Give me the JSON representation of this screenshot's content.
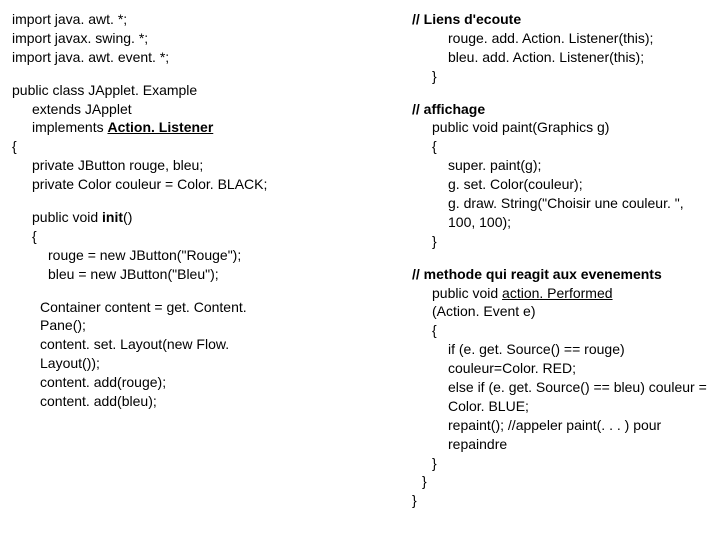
{
  "left": {
    "imports": [
      "import java. awt. *;",
      "import javax. swing. *;",
      "import java. awt. event. *;"
    ],
    "cls1": "public class JApplet. Example",
    "cls2": "extends JApplet",
    "cls3a": "implements ",
    "cls3b": "Action. Listener",
    "obr": "{",
    "priv1": "private JButton rouge, bleu;",
    "priv2": "private Color couleur = Color. BLACK;",
    "init1a": "public void ",
    "init1b": "init",
    "init1c": "()",
    "init2": "{",
    "init3": "rouge = new JButton(\"Rouge\");",
    "init4": "bleu = new JButton(\"Bleu\");",
    "cont1": "Container content = get. Content. Pane();",
    "cont2": "content. set. Layout(new Flow. Layout());",
    "cont3": "content. add(rouge);",
    "cont4": "content. add(bleu);"
  },
  "right": {
    "lh": "// Liens d'ecoute",
    "l1": "rouge. add. Action. Listener(this);",
    "l2": "bleu. add. Action. Listener(this);",
    "l3": "}",
    "ah": "// affichage",
    "a1": "public void paint(Graphics g)",
    "a2": "{",
    "a3": "super. paint(g);",
    "a4": "g. set. Color(couleur);",
    "a5": "g. draw. String(\"Choisir une couleur. \", 100, 100);",
    "a6": "}",
    "mh": "// methode qui reagit aux evenements",
    "m1a": "public void ",
    "m1b": "action. Performed",
    "m2": "(Action. Event e)",
    "m3": "{",
    "m4": "if (e. get. Source() == rouge) couleur=Color. RED;",
    "m5": "else if (e. get. Source() == bleu) couleur = Color. BLUE;",
    "m6": "repaint();    //appeler paint(. . . ) pour repaindre",
    "m7": "}",
    "m8": "}",
    "m9": "}"
  }
}
